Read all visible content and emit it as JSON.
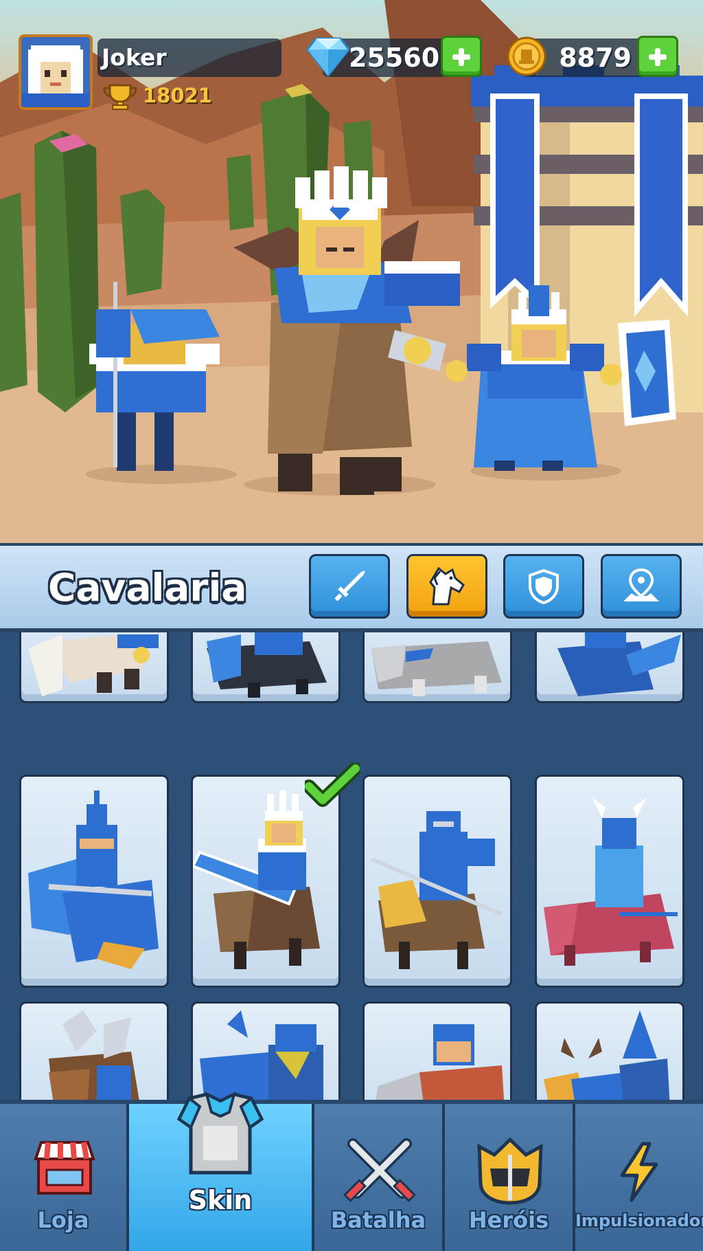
{
  "player": {
    "name": "Joker",
    "trophies": "18021"
  },
  "currency": {
    "gems": "25560",
    "coins": "8879"
  },
  "category": {
    "title": "Cavalaria",
    "tabs": [
      {
        "icon": "sword-icon",
        "active": false
      },
      {
        "icon": "horse-icon",
        "active": true
      },
      {
        "icon": "shield-icon",
        "active": false
      },
      {
        "icon": "map-pin-icon",
        "active": false
      }
    ]
  },
  "skins": {
    "equipped_index": 5,
    "cards": [
      {
        "mount": "eagle",
        "mount_color": "#e9ded0",
        "rider_color": "#2d6fd0"
      },
      {
        "mount": "dark-wolf",
        "mount_color": "#2d3440",
        "rider_color": "#2d6fd0"
      },
      {
        "mount": "gray-wolf",
        "mount_color": "#a7a9ad",
        "rider_color": "#2d6fd0"
      },
      {
        "mount": "blue-dragon",
        "mount_color": "#2a5fb8",
        "rider_color": "#2d6fd0"
      },
      {
        "mount": "blue-griffin",
        "mount_color": "#3a86e0",
        "rider_color": "#2d6fd0"
      },
      {
        "mount": "brown-horse",
        "mount_color": "#6a4a32",
        "rider_color": "#2d6fd0"
      },
      {
        "mount": "yellow-horse",
        "mount_color": "#7a5a3a",
        "rider_color": "#2d6fd0"
      },
      {
        "mount": "pink-boar",
        "mount_color": "#c0455e",
        "rider_color": "#4aa3e8"
      },
      {
        "mount": "armored-horse",
        "mount_color": "#7a5030",
        "rider_color": "#2d6fd0"
      },
      {
        "mount": "blue-bird",
        "mount_color": "#2f6fd2",
        "rider_color": "#d8c23a"
      },
      {
        "mount": "red-beast",
        "mount_color": "#c4583a",
        "rider_color": "#2d6fd0"
      },
      {
        "mount": "stag",
        "mount_color": "#2f6fd2",
        "rider_color": "#2d5fb0"
      }
    ]
  },
  "nav": {
    "items": [
      {
        "label": "Loja",
        "icon": "shop-icon"
      },
      {
        "label": "Skin",
        "icon": "armor-icon"
      },
      {
        "label": "Batalha",
        "icon": "crossed-swords-icon"
      },
      {
        "label": "Heróis",
        "icon": "helmet-icon"
      },
      {
        "label": "Impulsionador",
        "icon": "lightning-icon"
      }
    ],
    "active": "Skin"
  },
  "colors": {
    "accent": "#f2a10f",
    "tab_blue": "#2f8fd8",
    "panel": "#2d5078",
    "plus_green": "#5dd23a"
  }
}
